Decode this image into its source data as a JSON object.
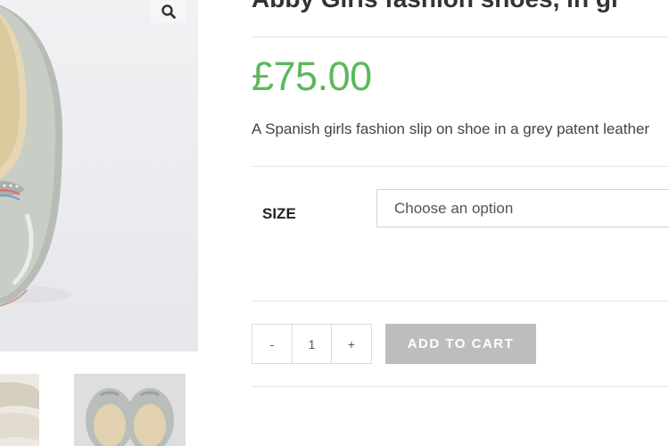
{
  "product": {
    "title": "Abby Girls fashion shoes, in gr",
    "price": "£75.00",
    "description": "A Spanish girls fashion slip on shoe in a grey patent leather"
  },
  "gallery": {
    "zoom_icon": "search-icon"
  },
  "variations": {
    "size_label": "SIZE",
    "size_selected": "Choose an option"
  },
  "cart": {
    "minus_label": "-",
    "quantity": "1",
    "plus_label": "+",
    "add_to_cart_label": "ADD TO CART"
  },
  "colors": {
    "price": "#5cb85c",
    "add_to_cart_bg": "#bdbdbd"
  }
}
